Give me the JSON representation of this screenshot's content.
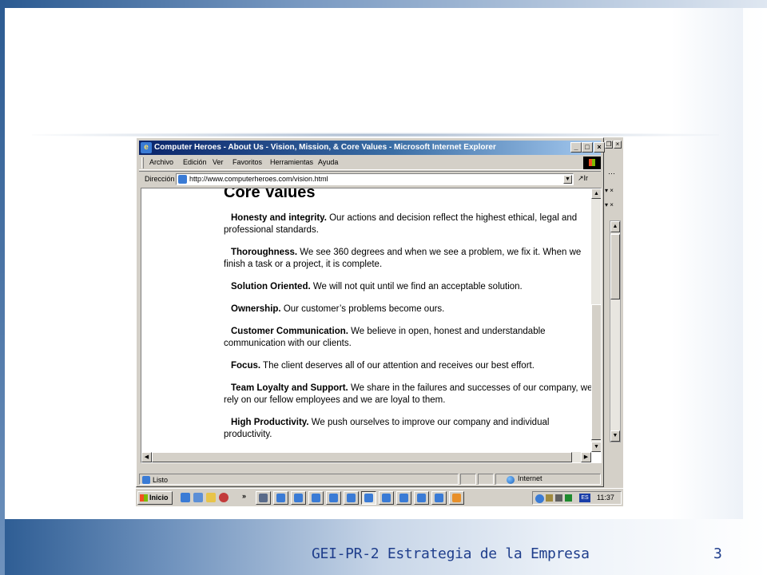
{
  "browser": {
    "window_title": "Computer Heroes - About Us - Vision, Mission, & Core Values - Microsoft Internet Explorer",
    "menu": [
      "Archivo",
      "Edición",
      "Ver",
      "Favoritos",
      "Herramientas",
      "Ayuda"
    ],
    "address_label": "Dirección",
    "url": "http://www.computerheroes.com/vision.html",
    "go_label": "Ir",
    "status_text": "Listo",
    "zone_text": "Internet"
  },
  "page": {
    "heading": "Core Values",
    "values": [
      {
        "title": "Honesty and integrity.",
        "text": " Our actions and decision reflect the highest ethical, legal and professional standards."
      },
      {
        "title": "Thoroughness.",
        "text": " We see 360 degrees and when we see a problem, we fix it. When we finish a task or a project, it is complete."
      },
      {
        "title": "Solution Oriented.",
        "text": " We will not quit until we find an acceptable solution."
      },
      {
        "title": "Ownership.",
        "text": " Our customer’s problems become ours."
      },
      {
        "title": "Customer Communication.",
        "text": " We believe in open, honest and understandable communication with our clients."
      },
      {
        "title": "Focus.",
        "text": " The client deserves all of our attention and receives our best effort."
      },
      {
        "title": "Team Loyalty and Support.",
        "text": " We share in the failures and successes of our company, we rely on our fellow employees and we are loyal to them."
      },
      {
        "title": "High Productivity.",
        "text": " We push ourselves to improve our company and individual productivity."
      }
    ]
  },
  "taskbar": {
    "start_label": "Inicio",
    "tray_lang": "ES",
    "clock": "11:37"
  },
  "slide": {
    "footer": "GEI-PR-2 Estrategia de la Empresa",
    "number": "3"
  },
  "colors": {
    "title_bar": "#0a246a",
    "slide_footer_text": "#1f3e8c",
    "slide_frame": "#2b5a91"
  }
}
